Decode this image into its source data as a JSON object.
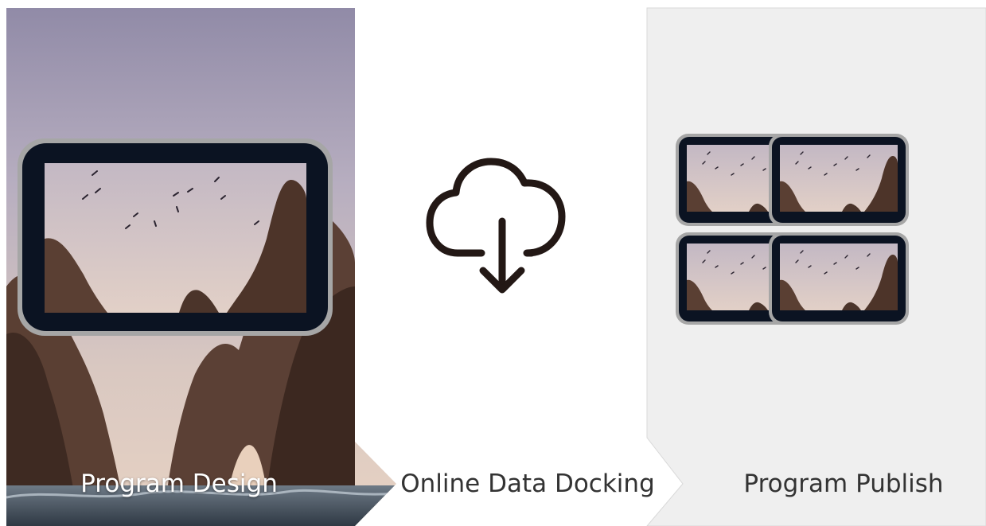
{
  "steps": [
    {
      "label": "Program Design",
      "icon": "photo-in-screen-icon"
    },
    {
      "label": "Online Data Docking",
      "icon": "cloud-download-icon"
    },
    {
      "label": "Program Publish",
      "icon": "video-wall-icon"
    }
  ],
  "colors": {
    "docking_bg": "#ffffff",
    "publish_bg": "#efefef",
    "screen_bezel": "#0b1322",
    "screen_frame": "#a6a6a6",
    "icon_stroke": "#231815",
    "label_dark": "#333333"
  }
}
